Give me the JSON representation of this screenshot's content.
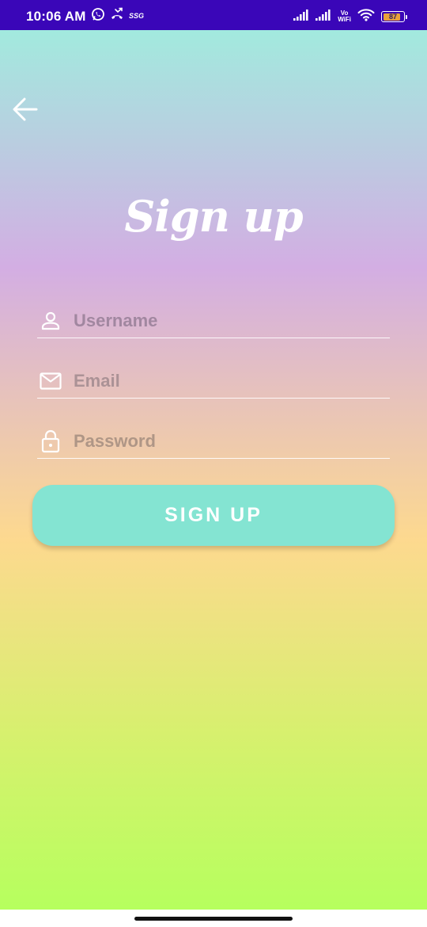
{
  "status_bar": {
    "time": "10:06 AM",
    "carrier_tag": "SSG",
    "vowifi_top": "Vo",
    "vowifi_bottom": "WiFi",
    "battery_level": "87",
    "battery_fraction": 0.87,
    "icons": [
      "whatsapp-icon",
      "missed-call-icon",
      "signal-icon",
      "signal-icon",
      "wifi-icon",
      "battery-icon"
    ]
  },
  "header": {
    "back_icon": "arrow-left-icon",
    "title": "Sign up"
  },
  "form": {
    "username": {
      "icon": "person-icon",
      "placeholder": "Username",
      "value": ""
    },
    "email": {
      "icon": "mail-icon",
      "placeholder": "Email",
      "value": ""
    },
    "password": {
      "icon": "lock-icon",
      "placeholder": "Password",
      "value": ""
    },
    "submit_label": "SIGN UP"
  },
  "colors": {
    "status_bar": "#3a06b8",
    "gradient_top": "#a2eade",
    "gradient_mid": "#d3aee3",
    "gradient_warm": "#fdd98f",
    "gradient_bottom": "#b6ff5e",
    "button": "#84e4d2",
    "text_on_accent": "#ffffff"
  }
}
